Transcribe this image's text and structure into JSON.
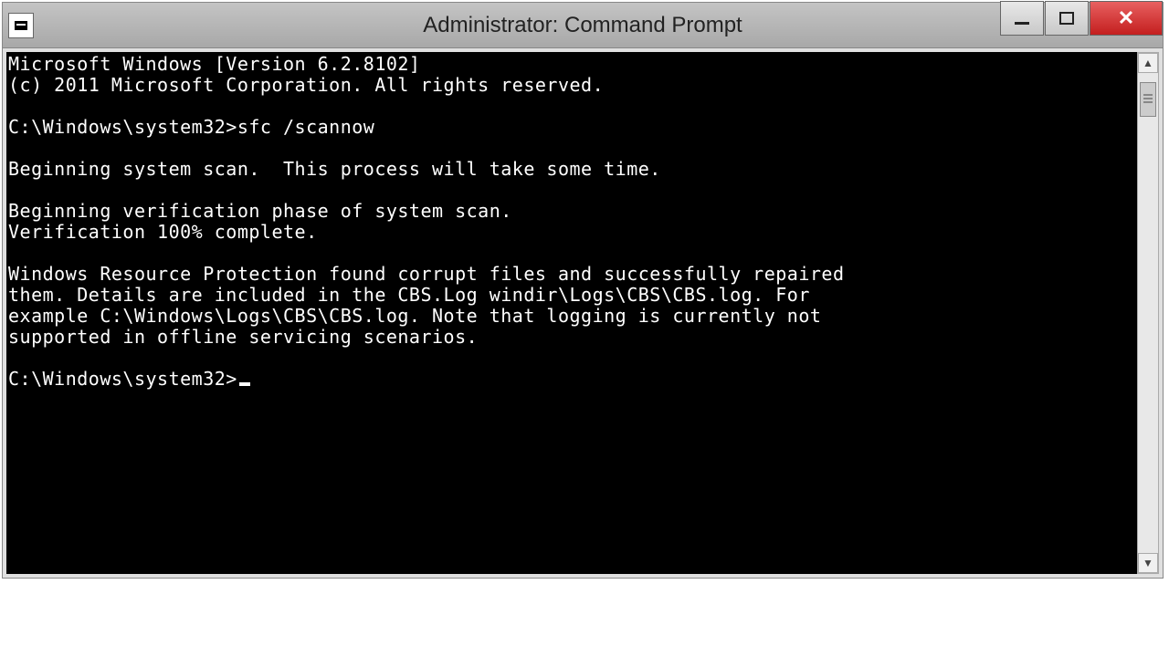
{
  "window": {
    "title": "Administrator: Command Prompt"
  },
  "terminal": {
    "lines": [
      "Microsoft Windows [Version 6.2.8102]",
      "(c) 2011 Microsoft Corporation. All rights reserved.",
      "",
      "C:\\Windows\\system32>sfc /scannow",
      "",
      "Beginning system scan.  This process will take some time.",
      "",
      "Beginning verification phase of system scan.",
      "Verification 100% complete.",
      "",
      "Windows Resource Protection found corrupt files and successfully repaired",
      "them. Details are included in the CBS.Log windir\\Logs\\CBS\\CBS.log. For",
      "example C:\\Windows\\Logs\\CBS\\CBS.log. Note that logging is currently not",
      "supported in offline servicing scenarios.",
      ""
    ],
    "prompt": "C:\\Windows\\system32>"
  }
}
